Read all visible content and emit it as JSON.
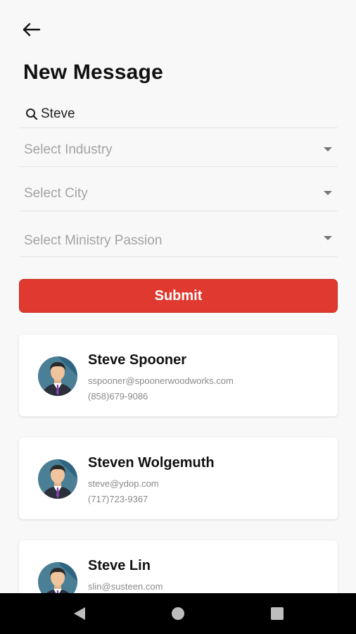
{
  "header": {
    "title": "New Message"
  },
  "search": {
    "value": "Steve"
  },
  "filters": [
    {
      "placeholder": "Select Industry"
    },
    {
      "placeholder": "Select City"
    },
    {
      "placeholder": "Select Ministry Passion"
    }
  ],
  "submit_label": "Submit",
  "contacts": [
    {
      "name": "Steve Spooner",
      "email": "sspooner@spoonerwoodworks.com",
      "phone": "(858)679-9086"
    },
    {
      "name": "Steven Wolgemuth",
      "email": "steve@ydop.com",
      "phone": "(717)723-9367"
    },
    {
      "name": "Steve Lin",
      "email": "slin@susteen.com",
      "phone": ""
    }
  ],
  "colors": {
    "accent": "#e0392f",
    "background": "#f8f8f8",
    "navbar": "#000000"
  },
  "icons": {
    "back": "arrow-left-icon",
    "search": "search-icon",
    "avatar": "person-avatar-icon",
    "dropdown": "caret-down-icon"
  }
}
